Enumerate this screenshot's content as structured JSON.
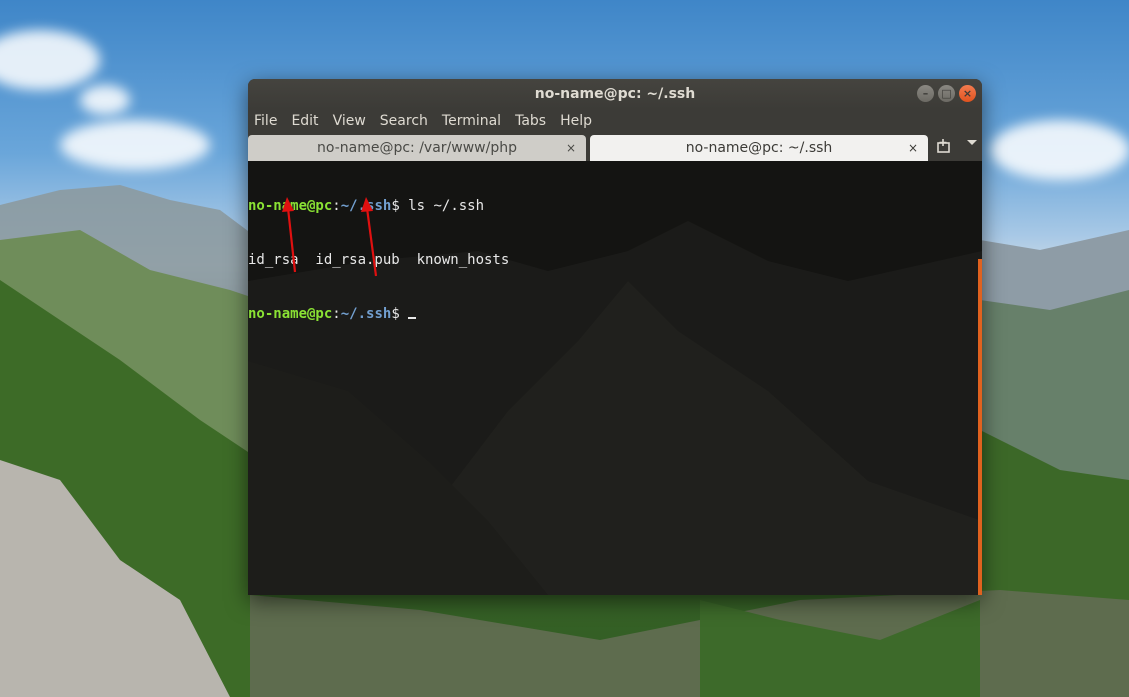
{
  "window": {
    "title": "no-name@pc: ~/.ssh",
    "buttons": {
      "minimize": "–",
      "maximize": "□",
      "close": "×"
    }
  },
  "menu": [
    "File",
    "Edit",
    "View",
    "Search",
    "Terminal",
    "Tabs",
    "Help"
  ],
  "tabs": [
    {
      "label": "no-name@pc: /var/www/php",
      "close": "×",
      "active": false
    },
    {
      "label": "no-name@pc: ~/.ssh",
      "close": "×",
      "active": true
    }
  ],
  "tabbar": {
    "new_tab_icon": "new-tab-icon",
    "menu_icon": "chevron-down-icon"
  },
  "terminal": {
    "line1": {
      "user_host": "no-name@pc",
      "sep": ":",
      "path": "~/.ssh",
      "prompt": "$ ",
      "command": "ls ~/.ssh"
    },
    "line2": {
      "output": "id_rsa  id_rsa.pub  known_hosts"
    },
    "line3": {
      "user_host": "no-name@pc",
      "sep": ":",
      "path": "~/.ssh",
      "prompt": "$ "
    }
  },
  "colors": {
    "accent": "#e0621f",
    "prompt_user": "#8ae234",
    "prompt_path": "#729fcf"
  }
}
